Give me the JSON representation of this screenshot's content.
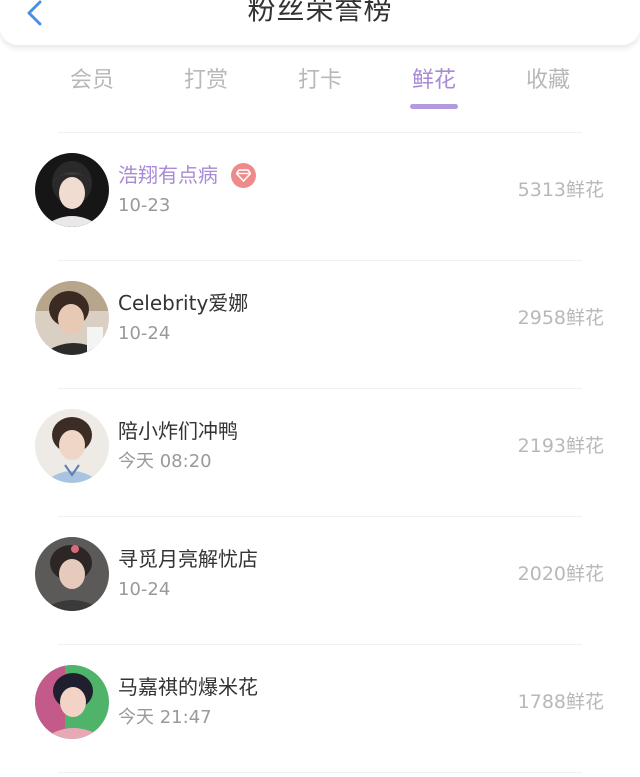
{
  "header": {
    "title": "粉丝荣誉榜",
    "back_icon": "chevron-left-icon",
    "accent_color": "#4a90e2"
  },
  "tabs": [
    {
      "label": "会员",
      "active": false
    },
    {
      "label": "打赏",
      "active": false
    },
    {
      "label": "打卡",
      "active": false
    },
    {
      "label": "鲜花",
      "active": true
    },
    {
      "label": "收藏",
      "active": false
    }
  ],
  "active_color": "#a88ad6",
  "ranking": [
    {
      "name": "浩翔有点病",
      "date": "10-23",
      "count": "5313鲜花",
      "vip": true,
      "badge_icon": "diamond-icon"
    },
    {
      "name": "Celebrity爱娜",
      "date": "10-24",
      "count": "2958鲜花",
      "vip": false
    },
    {
      "name": "陪小炸们冲鸭",
      "date": "今天 08:20",
      "count": "2193鲜花",
      "vip": false
    },
    {
      "name": "寻觅月亮解忧店",
      "date": "10-24",
      "count": "2020鲜花",
      "vip": false
    },
    {
      "name": "马嘉祺的爆米花",
      "date": "今天 21:47",
      "count": "1788鲜花",
      "vip": false
    }
  ]
}
